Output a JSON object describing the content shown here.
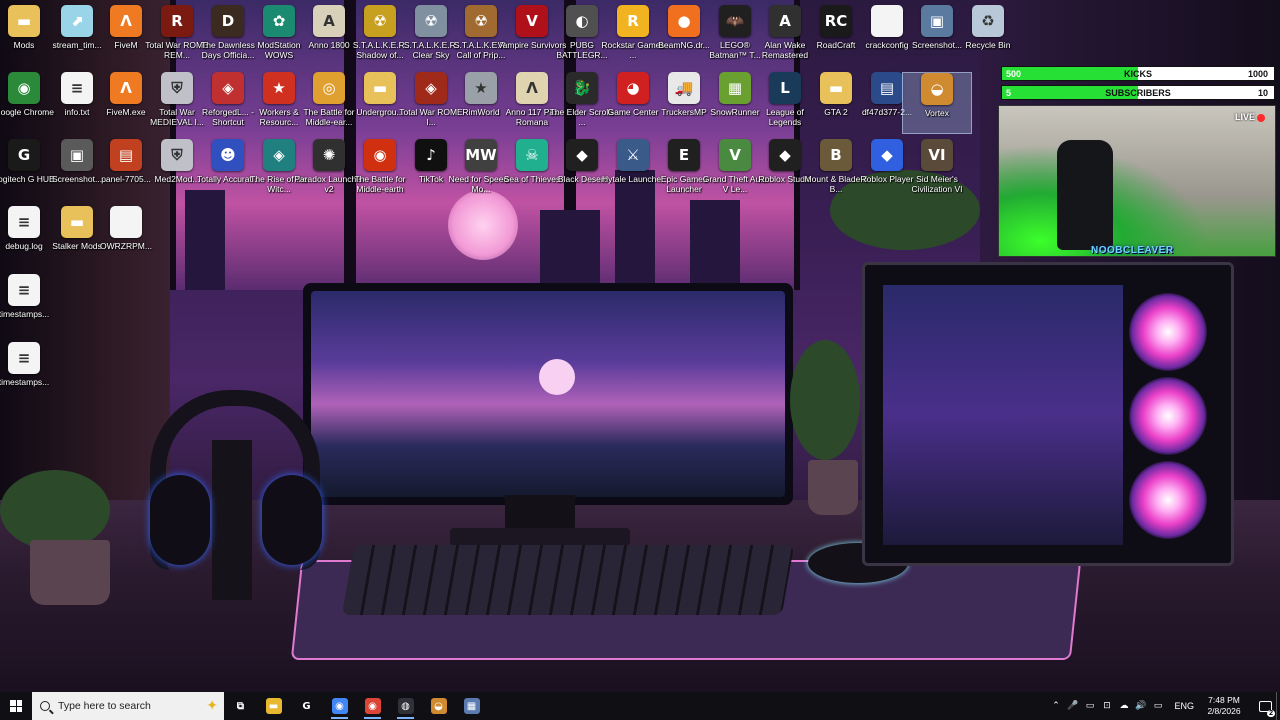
{
  "desktop_icons": [
    {
      "label": "Mods",
      "icon": "folder-icon",
      "color": "#e8c15a",
      "glyph": "▬"
    },
    {
      "label": "stream_tim...",
      "icon": "shortcut-icon",
      "color": "#9ad4e8",
      "glyph": "⬈"
    },
    {
      "label": "FiveM",
      "icon": "fivem-icon",
      "color": "#f07a22",
      "glyph": "Λ"
    },
    {
      "label": "Total War ROME REM...",
      "icon": "total-war-rome-remastered-icon",
      "color": "#7a1a10",
      "glyph": "R"
    },
    {
      "label": "The Dawnless Days Officia...",
      "icon": "dawnless-days-icon",
      "color": "#3a2a20",
      "glyph": "D"
    },
    {
      "label": "ModStation WOWS",
      "icon": "modstation-icon",
      "color": "#1a8a70",
      "glyph": "✿"
    },
    {
      "label": "Anno 1800",
      "icon": "anno-1800-icon",
      "color": "#d8d0b8",
      "glyph": "A"
    },
    {
      "label": "S.T.A.L.K.E.R. Shadow of...",
      "icon": "stalker-soc-icon",
      "color": "#c8a020",
      "glyph": "☢"
    },
    {
      "label": "S.T.A.L.K.E.R. Clear Sky",
      "icon": "stalker-clear-sky-icon",
      "color": "#8090a0",
      "glyph": "☢"
    },
    {
      "label": "S.T.A.L.K.E.R. Call of Prip...",
      "icon": "stalker-cop-icon",
      "color": "#a06a30",
      "glyph": "☢"
    },
    {
      "label": "Vampire Survivors",
      "icon": "vampire-survivors-icon",
      "color": "#b0101a",
      "glyph": "V"
    },
    {
      "label": "PUBG BATTLEGR...",
      "icon": "pubg-icon",
      "color": "#505050",
      "glyph": "◐"
    },
    {
      "label": "Rockstar Games ...",
      "icon": "rockstar-icon",
      "color": "#f2b320",
      "glyph": "R"
    },
    {
      "label": "BeamNG.dr...",
      "icon": "beamng-icon",
      "color": "#f07020",
      "glyph": "●"
    },
    {
      "label": "LEGO® Batman™ T...",
      "icon": "lego-batman-icon",
      "color": "#202020",
      "glyph": "🦇"
    },
    {
      "label": "Alan Wake Remastered",
      "icon": "alan-wake-icon",
      "color": "#303030",
      "glyph": "A"
    },
    {
      "label": "RoadCraft",
      "icon": "roadcraft-icon",
      "color": "#1a1a1a",
      "glyph": "RC"
    },
    {
      "label": "crackconfig",
      "icon": "file-icon",
      "color": "#f4f4f4",
      "glyph": ""
    },
    {
      "label": "Screenshot...",
      "icon": "image-file-icon",
      "color": "#5a7aa0",
      "glyph": "▣"
    },
    {
      "label": "Recycle Bin",
      "icon": "recycle-bin-icon",
      "color": "#b8c8d8",
      "glyph": "♻"
    },
    {
      "label": "Google Chrome",
      "icon": "chrome-icon",
      "color": "#2a8a3a",
      "glyph": "◉"
    },
    {
      "label": "info.txt",
      "icon": "text-file-icon",
      "color": "#f4f4f4",
      "glyph": "≡"
    },
    {
      "label": "FiveM.exe",
      "icon": "fivem-exe-icon",
      "color": "#f07a22",
      "glyph": "Λ"
    },
    {
      "label": "Total War MEDIEVAL I...",
      "icon": "total-war-medieval-icon",
      "color": "#c0c0c8",
      "glyph": "⛨"
    },
    {
      "label": "ReforgedL... - Shortcut",
      "icon": "reforged-shortcut-icon",
      "color": "#c03030",
      "glyph": "◈"
    },
    {
      "label": "Workers & Resourc...",
      "icon": "workers-resources-icon",
      "color": "#d03020",
      "glyph": "★"
    },
    {
      "label": "The Battle for Middle-ear...",
      "icon": "bfme-icon",
      "color": "#e0a030",
      "glyph": "◎"
    },
    {
      "label": "Undergrou...",
      "icon": "folder-icon",
      "color": "#e8c15a",
      "glyph": "▬"
    },
    {
      "label": "Total War ROME I...",
      "icon": "total-war-rome-icon",
      "color": "#a02a1a",
      "glyph": "◈"
    },
    {
      "label": "RimWorld",
      "icon": "rimworld-icon",
      "color": "#9aa0a8",
      "glyph": "★"
    },
    {
      "label": "Anno 117 Pax Romana",
      "icon": "anno-117-icon",
      "color": "#e0d4b0",
      "glyph": "Λ"
    },
    {
      "label": "The Elder Scrolls ...",
      "icon": "elder-scrolls-icon",
      "color": "#2a2a2a",
      "glyph": "🐉"
    },
    {
      "label": "Game Center",
      "icon": "game-center-icon",
      "color": "#d02020",
      "glyph": "◕"
    },
    {
      "label": "TruckersMP",
      "icon": "truckersmp-icon",
      "color": "#e8e8e8",
      "glyph": "🚚"
    },
    {
      "label": "SnowRunner",
      "icon": "snowrunner-icon",
      "color": "#6aa030",
      "glyph": "▦"
    },
    {
      "label": "League of Legends",
      "icon": "league-of-legends-icon",
      "color": "#1a3a5a",
      "glyph": "L"
    },
    {
      "label": "GTA 2",
      "icon": "folder-icon",
      "color": "#e8c15a",
      "glyph": "▬"
    },
    {
      "label": "df47d377-2...",
      "icon": "image-file-icon",
      "color": "#2a4a8a",
      "glyph": "▤"
    },
    {
      "label": "Vortex",
      "icon": "vortex-icon",
      "color": "#d08a30",
      "glyph": "◒"
    },
    {
      "label": "Logitech G HUB",
      "icon": "logitech-ghub-icon",
      "color": "#1a1a1a",
      "glyph": "G"
    },
    {
      "label": "Screenshot...",
      "icon": "image-file-icon",
      "color": "#5a5a5a",
      "glyph": "▣"
    },
    {
      "label": "panel-7705...",
      "icon": "image-file-icon",
      "color": "#c04020",
      "glyph": "▤"
    },
    {
      "label": "Med2Mod...",
      "icon": "med2mod-icon",
      "color": "#c0c0c8",
      "glyph": "⛨"
    },
    {
      "label": "Totally Accurat...",
      "icon": "tabs-icon",
      "color": "#3050c0",
      "glyph": "☻"
    },
    {
      "label": "The Rise of the Witc...",
      "icon": "rise-of-witchers-icon",
      "color": "#208080",
      "glyph": "◈"
    },
    {
      "label": "Paradox Launcher v2",
      "icon": "paradox-launcher-icon",
      "color": "#303030",
      "glyph": "✺"
    },
    {
      "label": "The Battle for Middle-earth",
      "icon": "bfme-eye-icon",
      "color": "#d03010",
      "glyph": "◉"
    },
    {
      "label": "TikTok",
      "icon": "tiktok-icon",
      "color": "#101010",
      "glyph": "♪"
    },
    {
      "label": "Need for Speed - Mo...",
      "icon": "nfs-most-wanted-icon",
      "color": "#404040",
      "glyph": "MW"
    },
    {
      "label": "Sea of Thieves",
      "icon": "sea-of-thieves-icon",
      "color": "#20b090",
      "glyph": "☠"
    },
    {
      "label": "Black Desert",
      "icon": "black-desert-icon",
      "color": "#202020",
      "glyph": "◆"
    },
    {
      "label": "Hytale Launcher",
      "icon": "hytale-icon",
      "color": "#3a5a8a",
      "glyph": "⚔"
    },
    {
      "label": "Epic Games Launcher",
      "icon": "epic-games-icon",
      "color": "#202020",
      "glyph": "E"
    },
    {
      "label": "Grand Theft Auto V Le...",
      "icon": "gta-v-icon",
      "color": "#4a8a40",
      "glyph": "V"
    },
    {
      "label": "Roblox Studio",
      "icon": "roblox-studio-icon",
      "color": "#202020",
      "glyph": "◆"
    },
    {
      "label": "Mount & Blade II B...",
      "icon": "bannerlord-icon",
      "color": "#6a5a3a",
      "glyph": "B"
    },
    {
      "label": "Roblox Player",
      "icon": "roblox-player-icon",
      "color": "#3060e0",
      "glyph": "◆"
    },
    {
      "label": "Sid Meier's Civilization VI",
      "icon": "civilization-vi-icon",
      "color": "#5a4a3a",
      "glyph": "VI"
    },
    {
      "label": "debug.log",
      "icon": "log-file-icon",
      "color": "#f4f4f4",
      "glyph": "≡"
    },
    {
      "label": "Stalker Mods",
      "icon": "folder-icon",
      "color": "#e8c15a",
      "glyph": "▬"
    },
    {
      "label": "OWRZRPM...",
      "icon": "file-icon",
      "color": "#f4f4f4",
      "glyph": ""
    },
    {
      "label": "timestamps...",
      "icon": "text-file-icon",
      "color": "#f4f4f4",
      "glyph": "≡"
    },
    {
      "label": "timestamps...",
      "icon": "text-file-icon",
      "color": "#f4f4f4",
      "glyph": "≡"
    }
  ],
  "overlay": {
    "kicks": {
      "current": "500",
      "label": "KICKS",
      "goal": "1000",
      "progress": 0.5
    },
    "subscribers": {
      "current": "5",
      "label": "SUBSCRIBERS",
      "goal": "10",
      "progress": 0.5
    },
    "webcam": {
      "live_label": "LIVE",
      "streamer_name": "NOOBCLEAVER"
    }
  },
  "taskbar": {
    "search_placeholder": "Type here to search",
    "apps": [
      {
        "name": "task-view",
        "icon": "task-view-icon",
        "glyph": "⧉",
        "color": "#101014",
        "active": false
      },
      {
        "name": "file-explorer",
        "icon": "file-explorer-icon",
        "glyph": "▬",
        "color": "#e8b830",
        "active": false
      },
      {
        "name": "logitech-ghub",
        "icon": "logitech-ghub-icon",
        "glyph": "G",
        "color": "#101014",
        "active": false
      },
      {
        "name": "chrome-profile",
        "icon": "chrome-icon",
        "glyph": "◉",
        "color": "#4285f4",
        "active": true
      },
      {
        "name": "chrome",
        "icon": "chrome-icon",
        "glyph": "◉",
        "color": "#db4437",
        "active": true
      },
      {
        "name": "obs-studio",
        "icon": "obs-icon",
        "glyph": "◍",
        "color": "#303038",
        "active": true
      },
      {
        "name": "vortex",
        "icon": "vortex-icon",
        "glyph": "◒",
        "color": "#d08a30",
        "active": false
      },
      {
        "name": "file-manager",
        "icon": "file-manager-icon",
        "glyph": "▦",
        "color": "#5a7ab0",
        "active": false
      }
    ],
    "tray_icons": [
      "chevron-up-icon",
      "microphone-icon",
      "device-icon",
      "network-icon",
      "speaker-icon",
      "wifi-icon",
      "battery-icon"
    ],
    "tray_glyphs": [
      "⌃",
      "🎤",
      "▭",
      "⊡",
      "☁",
      "🔊",
      "▭"
    ],
    "language": "ENG",
    "time": "7:48 PM",
    "date": "2/8/2026",
    "notifications": "2"
  }
}
